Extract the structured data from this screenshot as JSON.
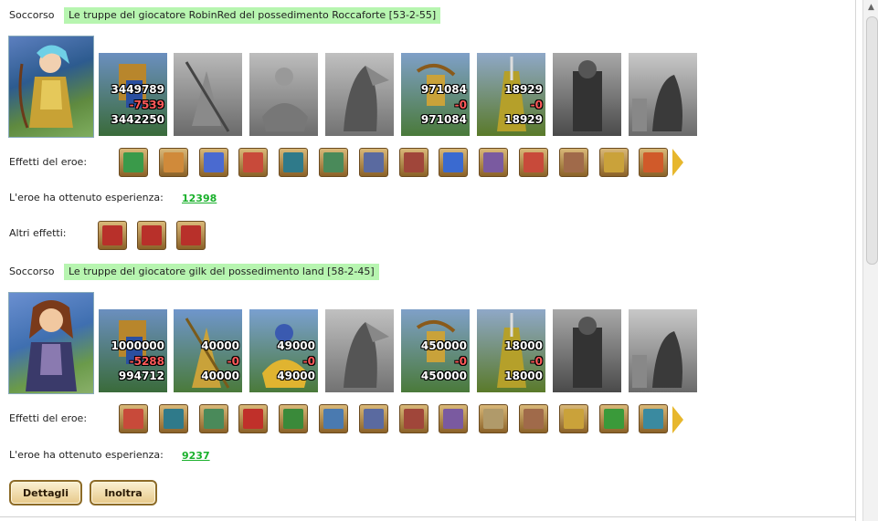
{
  "colors": {
    "highlight": "#b7f5b0",
    "xp": "#19b02b",
    "loss": "#ff5a5a",
    "button_border": "#8c6b28"
  },
  "labels": {
    "support": "Soccorso",
    "hero_effects": "Effetti del eroe:",
    "experience": "L'eroe ha ottenuto esperienza:",
    "other_effects": "Altri effetti:"
  },
  "reports": [
    {
      "title": "Le truppe del giocatore RobinRed del possedimento Roccaforte [53-2-55]",
      "units": [
        {
          "icon": "archer-unit",
          "active": true,
          "start": "3449789",
          "loss": "-7539",
          "end": "3442250"
        },
        {
          "icon": "spearman-unit",
          "active": false
        },
        {
          "icon": "knight-unit",
          "active": false
        },
        {
          "icon": "pegasus-unit",
          "active": false
        },
        {
          "icon": "crossbowman-unit",
          "active": true,
          "start": "971084",
          "loss": "-0",
          "end": "971084"
        },
        {
          "icon": "paladin-unit",
          "active": true,
          "start": "18929",
          "loss": "-0",
          "end": "18929"
        },
        {
          "icon": "swordsman-unit",
          "active": false
        },
        {
          "icon": "siege-unit",
          "active": false
        }
      ],
      "effects": [
        "sword-icon",
        "handshake-icon",
        "glove-icon",
        "dice-icon",
        "shield-icon",
        "handshake-shield-icon",
        "claw-icon",
        "chest-icon",
        "armor-icon",
        "ring-icon",
        "dice-icon",
        "bone-icon",
        "crest-shield-icon",
        "flame-shield-icon"
      ],
      "xp": "12398",
      "other_effects": [
        "heart-sword-icon",
        "heart-sword-icon",
        "heart-chain-icon"
      ]
    },
    {
      "title": "Le truppe del giocatore gilk del possedimento land [58-2-45]",
      "units": [
        {
          "icon": "archer-unit",
          "active": true,
          "start": "1000000",
          "loss": "-5288",
          "end": "994712"
        },
        {
          "icon": "spearman-unit",
          "active": true,
          "start": "40000",
          "loss": "-0",
          "end": "40000"
        },
        {
          "icon": "knight-unit",
          "active": true,
          "start": "49000",
          "loss": "-0",
          "end": "49000"
        },
        {
          "icon": "pegasus-unit",
          "active": false
        },
        {
          "icon": "crossbowman-unit",
          "active": true,
          "start": "450000",
          "loss": "-0",
          "end": "450000"
        },
        {
          "icon": "paladin-unit",
          "active": true,
          "start": "18000",
          "loss": "-0",
          "end": "18000"
        },
        {
          "icon": "swordsman-unit",
          "active": false
        },
        {
          "icon": "siege-unit",
          "active": false
        }
      ],
      "effects": [
        "dice-icon",
        "shield-icon",
        "handshake-shield-icon",
        "xp-icon",
        "xp-badge-icon",
        "helmet-icon",
        "claw-icon",
        "chest-icon",
        "ring-icon",
        "scroll-icon",
        "bone-icon",
        "crest-shield-icon",
        "heart-snake-icon",
        "globe-shield-icon"
      ],
      "xp": "9237"
    }
  ],
  "buttons": {
    "details": "Dettagli",
    "forward": "Inoltra"
  }
}
